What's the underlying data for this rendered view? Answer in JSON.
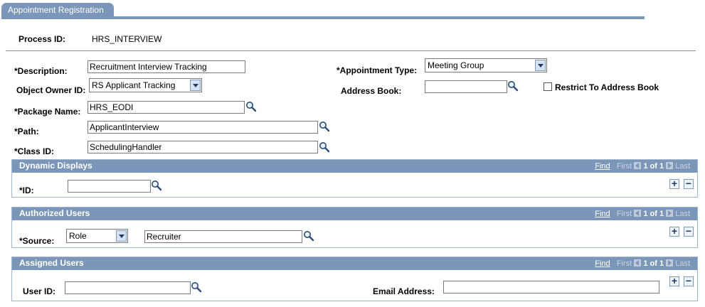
{
  "page_tab": "Appointment Registration",
  "process": {
    "label": "Process ID:",
    "value": "HRS_INTERVIEW"
  },
  "fields": {
    "description": {
      "label": "*Description:",
      "value": "Recruitment Interview Tracking"
    },
    "object_owner": {
      "label": "Object Owner ID:",
      "value": "RS Applicant Tracking"
    },
    "package_name": {
      "label": "*Package Name:",
      "value": "HRS_EODI"
    },
    "path": {
      "label": "*Path:",
      "value": "ApplicantInterview"
    },
    "class_id": {
      "label": "*Class ID:",
      "value": "SchedulingHandler"
    },
    "appointment_type": {
      "label": "*Appointment Type:",
      "value": "Meeting Group"
    },
    "address_book": {
      "label": "Address Book:",
      "value": ""
    },
    "restrict": {
      "label": "Restrict To Address Book",
      "checked": false
    }
  },
  "nav": {
    "find": "Find",
    "first": "First",
    "page": "1 of 1",
    "last": "Last"
  },
  "sections": {
    "dynamic_displays": {
      "title": "Dynamic Displays",
      "id_label": "*ID:",
      "id_value": ""
    },
    "authorized_users": {
      "title": "Authorized Users",
      "source_label": "*Source:",
      "source_value": "Role",
      "value": "Recruiter"
    },
    "assigned_users": {
      "title": "Assigned Users",
      "user_label": "User ID:",
      "user_value": "",
      "email_label": "Email Address:",
      "email_value": ""
    }
  },
  "icons": {
    "lookup": "magnifier-icon",
    "add": "plus-icon",
    "remove": "minus-icon",
    "dropdown": "chevron-down-icon"
  },
  "colors": {
    "header": "#7b96b8",
    "border": "#9fb5cf"
  }
}
